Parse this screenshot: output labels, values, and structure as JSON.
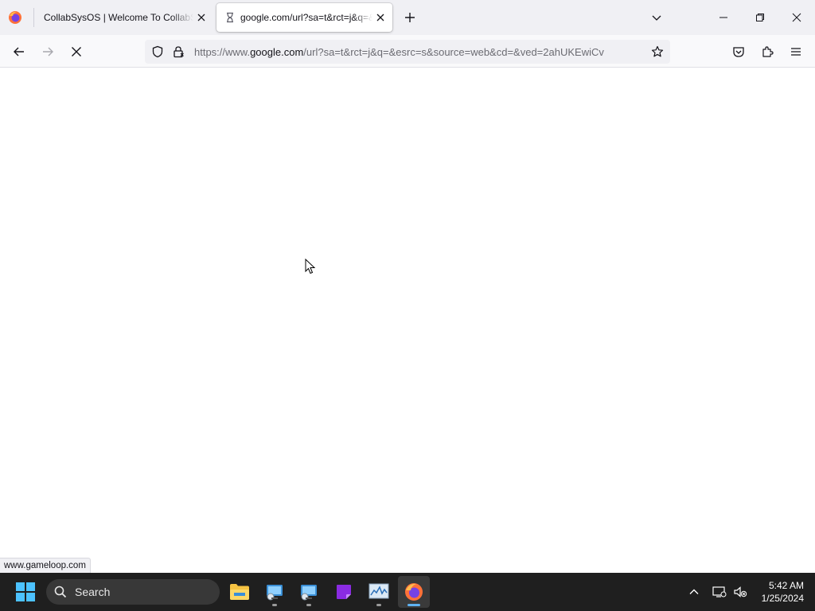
{
  "tabs": [
    {
      "title": "CollabSysOS | Welcome To CollabSysOS",
      "active": false
    },
    {
      "title": "google.com/url?sa=t&rct=j&q=&esrc=s",
      "active": true
    }
  ],
  "url": {
    "prefix": "https://www.",
    "host": "google.com",
    "rest": "/url?sa=t&rct=j&q=&esrc=s&source=web&cd=&ved=2ahUKEwiCv"
  },
  "status_link": "www.gameloop.com",
  "taskbar": {
    "search_label": "Search",
    "apps": [
      "file-explorer",
      "network-app",
      "network-app-2",
      "purple-app",
      "task-manager",
      "firefox"
    ]
  },
  "clock": {
    "time": "5:42 AM",
    "date": "1/25/2024"
  },
  "colors": {
    "tabbar": "#f0f0f4",
    "taskbar": "#1f1f1f",
    "accent": "#5fb2f2"
  }
}
